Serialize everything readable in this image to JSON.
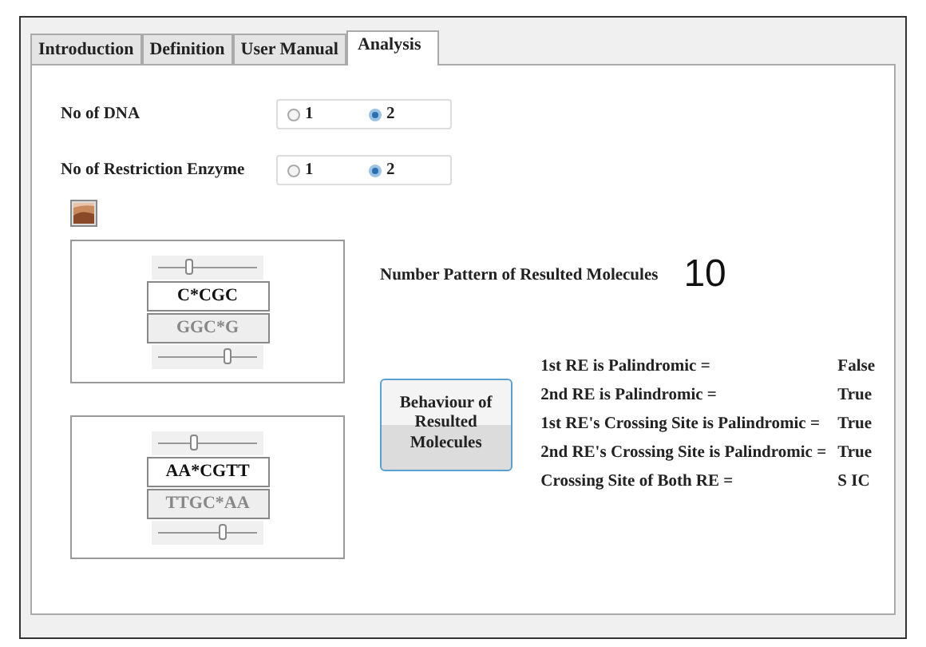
{
  "tabs": [
    {
      "label": "Introduction",
      "selected": false
    },
    {
      "label": "Definition",
      "selected": false
    },
    {
      "label": "User Manual",
      "selected": false
    },
    {
      "label": "Analysis",
      "selected": true
    }
  ],
  "options": [
    {
      "label": "No of DNA",
      "choices": [
        {
          "label": "1",
          "selected": false
        },
        {
          "label": "2",
          "selected": true
        }
      ]
    },
    {
      "label": "No of Restriction Enzyme",
      "choices": [
        {
          "label": "1",
          "selected": false
        },
        {
          "label": "2",
          "selected": true
        }
      ]
    }
  ],
  "sequences": [
    {
      "top_slider": {
        "level": 0.3
      },
      "strand_top": "C*CGC",
      "strand_bottom": "GGC*G",
      "bottom_slider": {
        "level": 0.7
      }
    },
    {
      "top_slider": {
        "level": 0.35
      },
      "strand_top": "AA*CGTT",
      "strand_bottom": "TTGC*AA",
      "bottom_slider": {
        "level": 0.65
      }
    }
  ],
  "pattern": {
    "label": "Number Pattern of Resulted Molecules",
    "value": "10"
  },
  "behaviour_button": "Behaviour of Resulted Molecules",
  "results": [
    {
      "label": "1st RE is Palindromic =",
      "value": "False"
    },
    {
      "label": "2nd RE is Palindromic =",
      "value": "True"
    },
    {
      "label": "1st RE's Crossing Site is Palindromic =",
      "value": "True"
    },
    {
      "label": "2nd RE's Crossing Site is Palindromic =",
      "value": "True"
    },
    {
      "label": "Crossing Site of Both RE =",
      "value": "S IC"
    }
  ]
}
